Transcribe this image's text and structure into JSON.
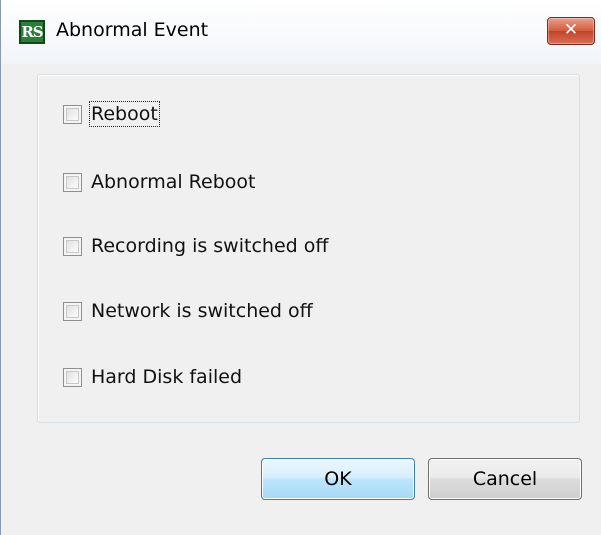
{
  "window": {
    "title": "Abnormal Event",
    "app_icon_text": "RS",
    "close_glyph": "✕"
  },
  "options": [
    {
      "label": "Reboot",
      "checked": false,
      "focused": true
    },
    {
      "label": "Abnormal Reboot",
      "checked": false,
      "focused": false
    },
    {
      "label": "Recording is switched off",
      "checked": false,
      "focused": false
    },
    {
      "label": "Network is switched off",
      "checked": false,
      "focused": false
    },
    {
      "label": "Hard Disk failed",
      "checked": false,
      "focused": false
    }
  ],
  "buttons": {
    "ok_label": "OK",
    "cancel_label": "Cancel"
  },
  "icons": {
    "app": "rs-app-icon",
    "close": "close-icon"
  },
  "colors": {
    "close_button": "#c24428",
    "ok_button_border": "#3c7fb1",
    "dialog_background": "#f0f0f0"
  }
}
